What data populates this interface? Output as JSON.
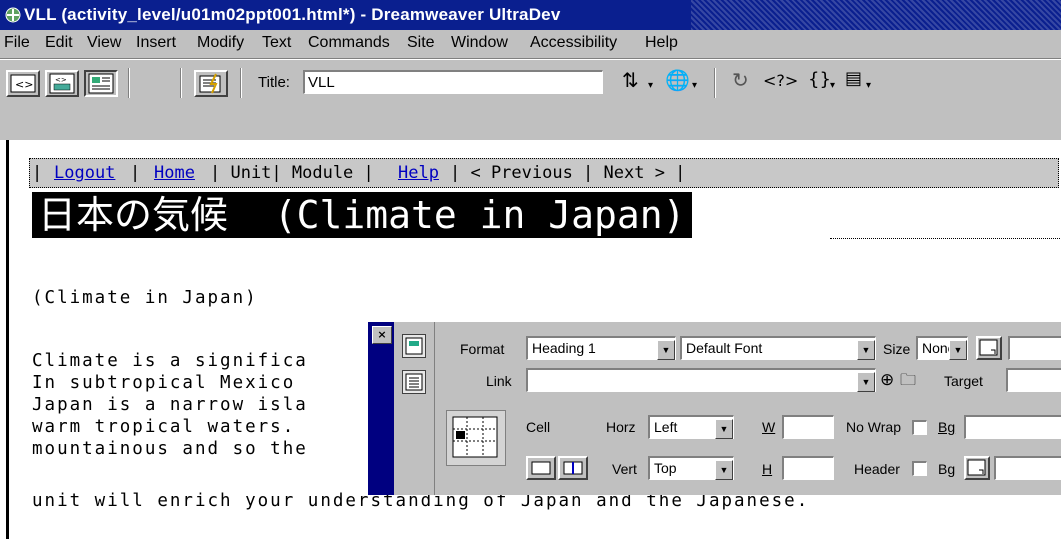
{
  "window": {
    "title": "VLL (activity_level/u01m02ppt001.html*) - Dreamweaver UltraDev"
  },
  "menu": [
    "File",
    "Edit",
    "View",
    "Insert",
    "Modify",
    "Text",
    "Commands",
    "Site",
    "Window",
    "Accessibility",
    "Help"
  ],
  "toolbar": {
    "title_label": "Title:",
    "title_value": "VLL",
    "icons": [
      "code-view-icon",
      "split-view-icon",
      "design-view-icon",
      "live-data-icon",
      "file-management-icon",
      "preview-globe-icon",
      "refresh-icon",
      "reference-icon",
      "code-navigation-icon",
      "view-options-icon"
    ]
  },
  "document": {
    "nav": {
      "logout": "Logout",
      "sep1": "|",
      "home": "Home",
      "unit_module": "| Unit| Module |",
      "help": "Help",
      "prev_next": "| < Previous | Next > |"
    },
    "heading": "日本の気候  (Climate in Japan)",
    "subtitle": "(Climate in Japan)",
    "paragraph": [
      "Climate is a significa",
      "In subtropical Mexico",
      "Japan is a narrow isla",
      "warm tropical waters.",
      "mountainous and so the",
      "unit will enrich your understanding of Japan and the Japanese."
    ]
  },
  "inspector": {
    "format_label": "Format",
    "format_value": "Heading 1",
    "font_value": "Default Font",
    "size_label": "Size",
    "size_value": "None",
    "link_label": "Link",
    "link_value": "",
    "target_label": "Target",
    "cell_label": "Cell",
    "horz_label": "Horz",
    "horz_value": "Left",
    "vert_label": "Vert",
    "vert_value": "Top",
    "w_label": "W",
    "h_label": "H",
    "nowrap_label": "No Wrap",
    "header_label": "Header",
    "bg_label": "Bg",
    "bg2_label": "Bg"
  }
}
